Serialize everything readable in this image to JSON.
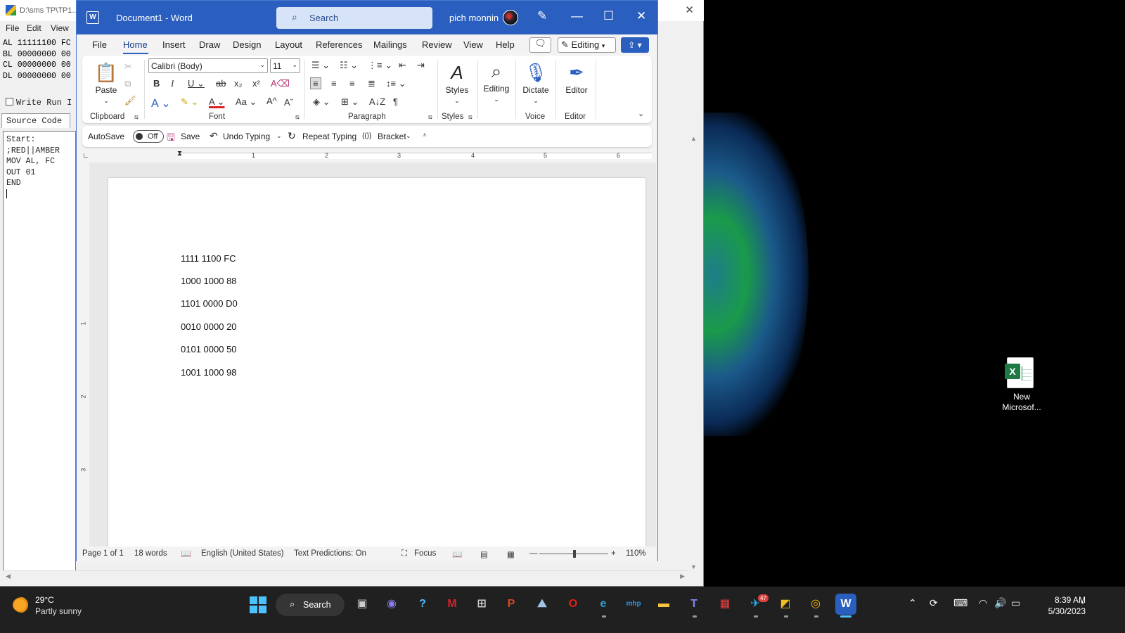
{
  "sms": {
    "title": "D:\\sms TP\\TP1...",
    "menu": [
      "File",
      "Edit",
      "View"
    ],
    "registers": [
      "AL 11111100 FC",
      "BL 00000000 00",
      "CL 00000000 00",
      "DL 00000000 00"
    ],
    "write_run_label": "Write Run I",
    "source_tab": "Source Code",
    "source_lines": [
      "Start:",
      ";RED||AMBER",
      "MOV AL, FC",
      "OUT 01",
      "END"
    ]
  },
  "word": {
    "title": "Document1  -  Word",
    "search_label": "Search",
    "user_name": "pich monnin",
    "tabs": [
      "File",
      "Home",
      "Insert",
      "Draw",
      "Design",
      "Layout",
      "References",
      "Mailings",
      "Review",
      "View",
      "Help"
    ],
    "active_tab": "Home",
    "editing_mode": "Editing",
    "ribbon": {
      "paste": "Paste",
      "clipboard": "Clipboard",
      "font_name": "Calibri (Body)",
      "font_size": "11",
      "font": "Font",
      "paragraph": "Paragraph",
      "styles_btn": "Styles",
      "styles": "Styles",
      "editing_btn": "Editing",
      "dictate_btn": "Dictate",
      "voice": "Voice",
      "editor_btn": "Editor",
      "editor": "Editor"
    },
    "qat": {
      "autosave": "AutoSave",
      "autosave_state": "Off",
      "save": "Save",
      "undo": "Undo Typing",
      "repeat": "Repeat Typing",
      "bracket": "Bracket"
    },
    "ruler_numbers": [
      "1",
      "2",
      "3",
      "4",
      "5",
      "6"
    ],
    "vruler_numbers": [
      "1",
      "2",
      "3"
    ],
    "document_lines": [
      "1111 1100 FC",
      "1000 1000 88",
      "1101 0000 D0",
      "0010 0000 20",
      "0101 0000 50",
      "1001 1000 98"
    ],
    "status": {
      "page": "Page 1 of 1",
      "words": "18 words",
      "language": "English (United States)",
      "predictions": "Text Predictions: On",
      "focus": "Focus",
      "zoom": "110%"
    }
  },
  "desktop": {
    "icon_label_line1": "New",
    "icon_label_line2": "Microsof..."
  },
  "taskbar": {
    "temperature": "29°C",
    "weather": "Partly sunny",
    "search": "Search",
    "telegram_badge": "47",
    "time": "8:39 AM",
    "date": "5/30/2023"
  }
}
